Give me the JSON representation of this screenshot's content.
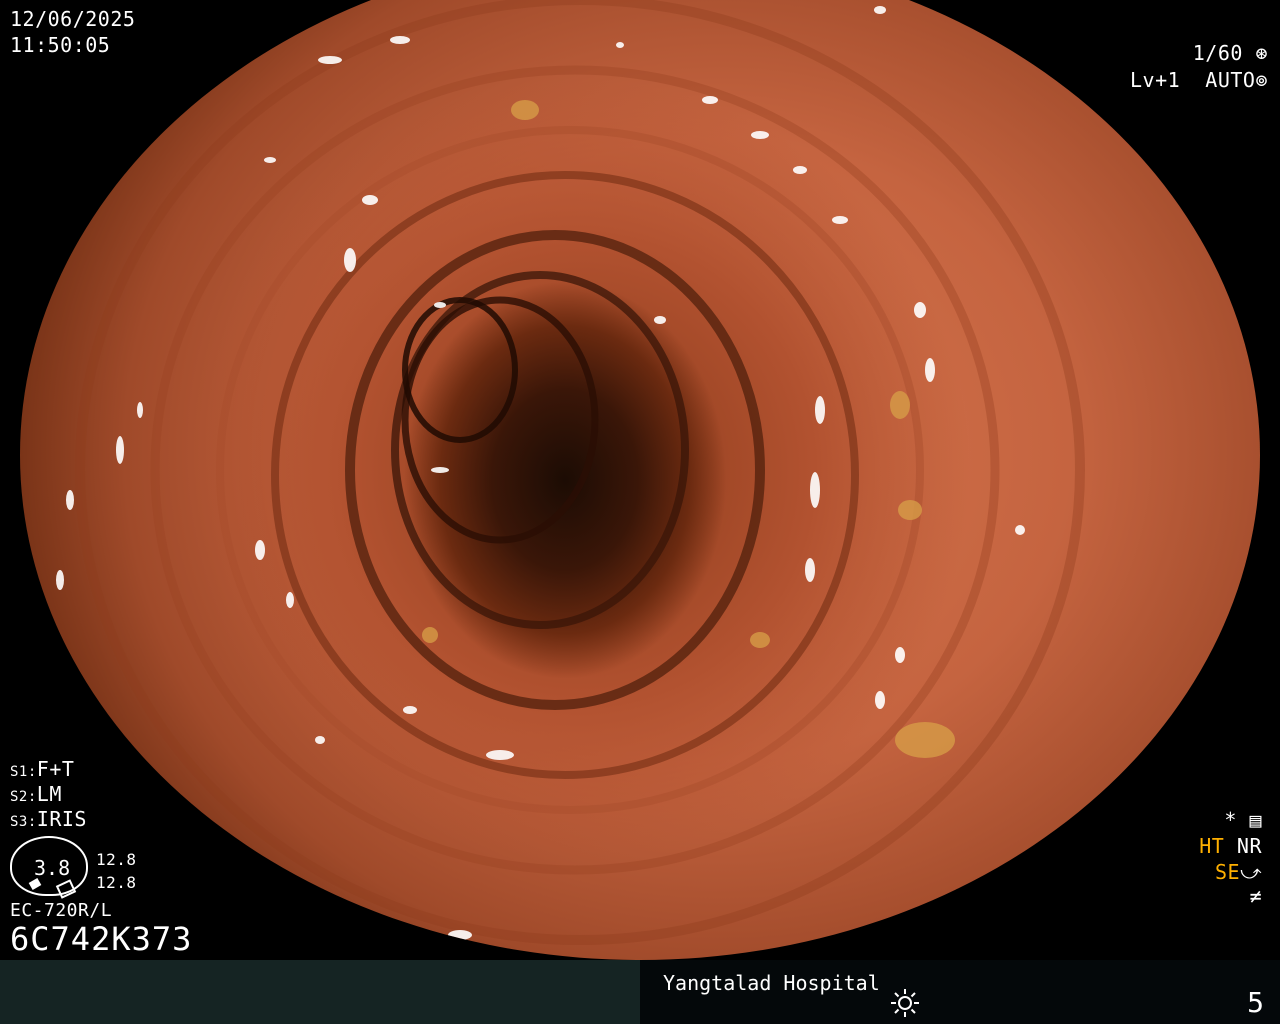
{
  "header": {
    "date": "12/06/2025",
    "time": "11:50:05"
  },
  "camera": {
    "shutter": "1/60",
    "shutter_icon": "aperture-icon",
    "level": "Lv+1",
    "exposure_mode": "AUTO",
    "exposure_icon": "iris-icon"
  },
  "settings": [
    {
      "key": "S1:",
      "value": "F+T"
    },
    {
      "key": "S2:",
      "value": "LM"
    },
    {
      "key": "S3:",
      "value": "IRIS"
    }
  ],
  "gauge": {
    "value": "3.8",
    "reading_a": "12.8",
    "reading_b": "12.8"
  },
  "scope": {
    "model": "EC-720R/L",
    "serial": "6C742K373"
  },
  "indicators": {
    "star": "*",
    "star_icon": "settings-panel-icon",
    "ht": "HT",
    "nr": "NR",
    "se": "SE",
    "se_icon": "enhancement-curve-icon",
    "slash_icon": "not-equal-icon"
  },
  "footer": {
    "hospital": "Yangtalad Hospital",
    "light_icon": "brightness-icon",
    "page": "5"
  },
  "colors": {
    "accent": "#ffb000",
    "text": "#ffffff",
    "footer_left": "#152423",
    "footer_right": "#04080a"
  }
}
